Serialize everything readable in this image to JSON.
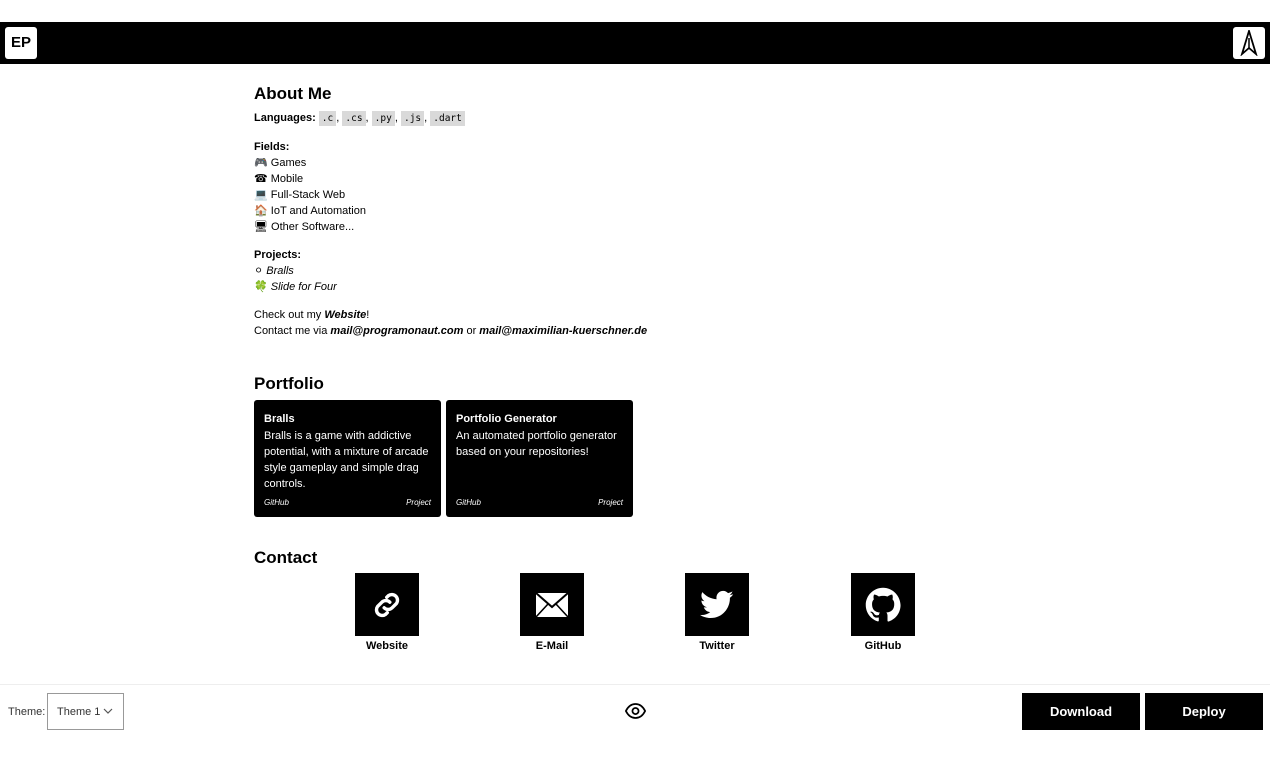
{
  "header": {
    "logo_text": "EP",
    "right_logo_icon": "rocket-logo-icon"
  },
  "about": {
    "title": "About Me",
    "languages_label": "Languages:",
    "languages": [
      ".c",
      ".cs",
      ".py",
      ".js",
      ".dart"
    ],
    "fields_label": "Fields:",
    "fields": [
      {
        "icon": "🎮",
        "label": "Games"
      },
      {
        "icon": "☎",
        "label": "Mobile"
      },
      {
        "icon": "💻",
        "label": "Full-Stack Web"
      },
      {
        "icon": "🏠",
        "label": "IoT and Automation"
      },
      {
        "icon": "🖥",
        "label": "Other Software..."
      }
    ],
    "projects_label": "Projects:",
    "projects": [
      {
        "icon": "⚪",
        "label": "Bralls"
      },
      {
        "icon": "🍀",
        "label": "Slide for Four"
      }
    ],
    "checkout_prefix": "Check out my ",
    "checkout_link": "Website",
    "checkout_suffix": "!",
    "contact_prefix": "Contact me via ",
    "email1": "mail@programonaut.com",
    "contact_or": " or ",
    "email2": "mail@maximilian-kuerschner.de"
  },
  "portfolio": {
    "title": "Portfolio",
    "cards": [
      {
        "title": "Bralls",
        "description": "Bralls is a game with addictive potential, with a mixture of arcade style gameplay and simple drag controls.",
        "source": "GitHub",
        "type": "Project"
      },
      {
        "title": "Portfolio Generator",
        "description": "An automated portfolio generator based on your repositories!",
        "source": "GitHub",
        "type": "Project"
      }
    ]
  },
  "contact": {
    "title": "Contact",
    "items": [
      {
        "label": "Website",
        "icon": "link-icon"
      },
      {
        "label": "E-Mail",
        "icon": "mail-icon"
      },
      {
        "label": "Twitter",
        "icon": "twitter-icon"
      },
      {
        "label": "GitHub",
        "icon": "github-icon"
      }
    ]
  },
  "footer": {
    "theme_label": "Theme:",
    "theme_value": "Theme 1",
    "preview_icon": "eye-icon",
    "download_label": "Download",
    "deploy_label": "Deploy"
  }
}
